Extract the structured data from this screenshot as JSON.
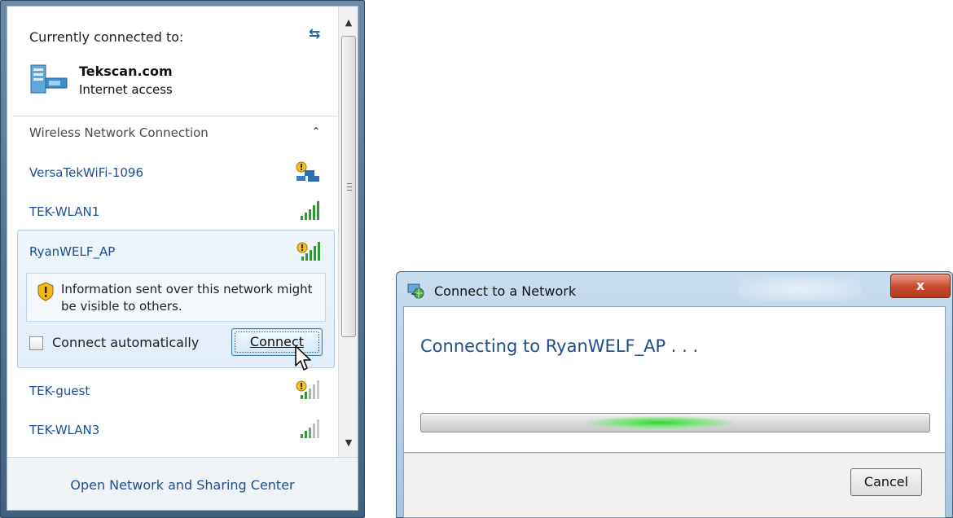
{
  "flyout": {
    "header": "Currently connected to:",
    "connection": {
      "name": "Tekscan.com",
      "status": "Internet access"
    },
    "section_label": "Wireless Network Connection",
    "networks": [
      {
        "name": "VersaTekWiFi-1096",
        "icon": "network-unsecured-icon"
      },
      {
        "name": "TEK-WLAN1",
        "icon": "signal-strength-icon"
      }
    ],
    "selected": {
      "name": "RyanWELF_AP",
      "icon": "signal-unsecured-icon",
      "warning": "Information sent over this network might be visible to others.",
      "auto_connect_label": "Connect automatically",
      "auto_connect_checked": false,
      "connect_label": "Connect"
    },
    "more_networks": [
      {
        "name": "TEK-guest",
        "icon": "signal-unsecured-icon"
      },
      {
        "name": "TEK-WLAN3",
        "icon": "signal-strength-icon"
      }
    ],
    "footer_link": "Open Network and Sharing Center"
  },
  "dialog": {
    "title": "Connect to a Network",
    "close_label": "x",
    "heading": "Connecting to RyanWELF_AP . . .",
    "progress": {
      "mode": "indeterminate",
      "pulse_center_fraction": 0.47
    },
    "cancel_label": "Cancel"
  },
  "colors": {
    "link_blue": "#1d4f91",
    "signal_green": "#2f9a2f",
    "progress_green": "#35d235",
    "close_red": "#c8482c"
  }
}
